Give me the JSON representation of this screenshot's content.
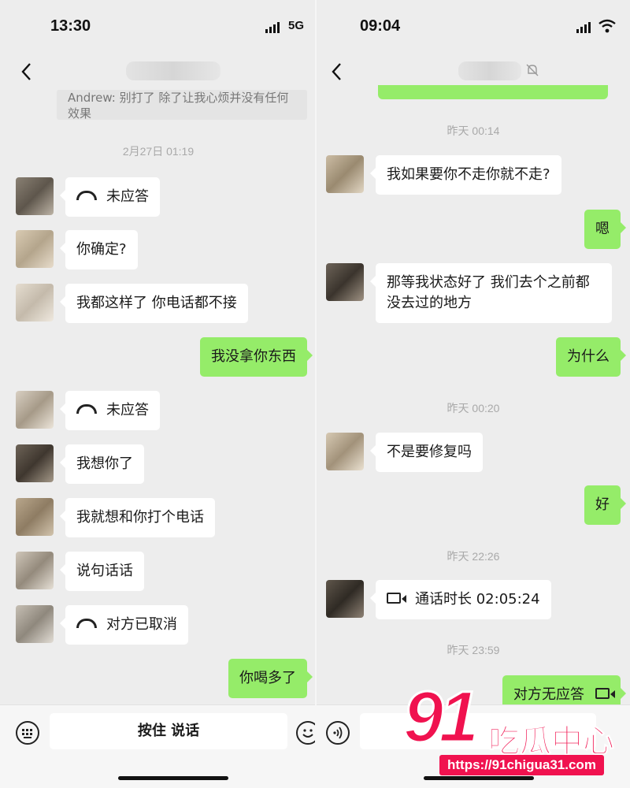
{
  "left_screen": {
    "status": {
      "time": "13:30",
      "network": "5G"
    },
    "quote_text": "Andrew: 别打了 除了让我心烦并没有任何效果",
    "messages": [
      {
        "type": "timestamp",
        "text": "2月27日 01:19"
      },
      {
        "type": "in",
        "call": true,
        "text": "未应答"
      },
      {
        "type": "in",
        "text": "你确定?"
      },
      {
        "type": "in",
        "text": "我都这样了 你电话都不接"
      },
      {
        "type": "out",
        "text": "我没拿你东西"
      },
      {
        "type": "in",
        "call": true,
        "text": "未应答"
      },
      {
        "type": "in",
        "text": "我想你了"
      },
      {
        "type": "in",
        "text": "我就想和你打个电话"
      },
      {
        "type": "in",
        "text": "说句话话"
      },
      {
        "type": "in",
        "call": true,
        "text": "对方已取消"
      },
      {
        "type": "out",
        "text": "你喝多了"
      }
    ],
    "input": {
      "hold_to_talk": "按住 说话"
    }
  },
  "right_screen": {
    "status": {
      "time": "09:04"
    },
    "messages": [
      {
        "type": "timestamp",
        "text": "昨天 00:14"
      },
      {
        "type": "in",
        "text": "我如果要你不走你就不走?"
      },
      {
        "type": "out",
        "text": "嗯"
      },
      {
        "type": "in",
        "text": "那等我状态好了 我们去个之前都没去过的地方"
      },
      {
        "type": "out",
        "text": "为什么"
      },
      {
        "type": "timestamp",
        "text": "昨天 00:20"
      },
      {
        "type": "in",
        "text": "不是要修复吗"
      },
      {
        "type": "out",
        "text": "好"
      },
      {
        "type": "timestamp",
        "text": "昨天 22:26"
      },
      {
        "type": "in",
        "video": true,
        "text": "通话时长 02:05:24"
      },
      {
        "type": "timestamp",
        "text": "昨天 23:59"
      },
      {
        "type": "out",
        "video": true,
        "text": "对方无应答"
      }
    ]
  },
  "watermark": {
    "number": "91",
    "name": "吃瓜中心",
    "url": "https://91chigua31.com"
  },
  "colors": {
    "background": "#ededed",
    "outgoing_bubble": "#95ec69",
    "incoming_bubble": "#ffffff",
    "timestamp": "#a9a9a9",
    "watermark": "#f0124f"
  }
}
